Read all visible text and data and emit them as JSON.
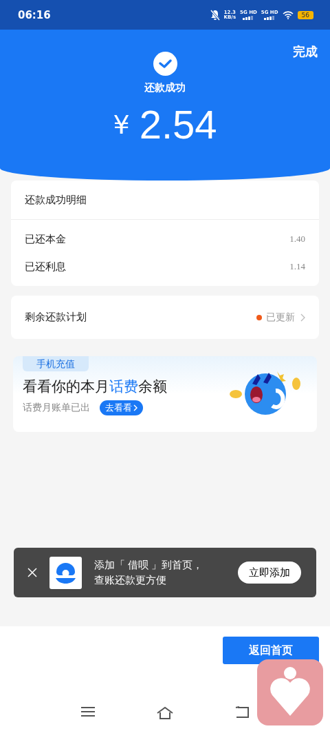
{
  "status_bar": {
    "time": "06:16",
    "speed_value": "12.3",
    "speed_unit": "KB/s",
    "networks": [
      "5G HD",
      "5G HD"
    ],
    "battery": "56"
  },
  "header": {
    "done": "完成",
    "title": "还款成功",
    "currency": "¥",
    "amount": "2.54"
  },
  "details": {
    "title": "还款成功明细",
    "rows": [
      {
        "label": "已还本金",
        "value": "1.40"
      },
      {
        "label": "已还利息",
        "value": "1.14"
      }
    ]
  },
  "plan": {
    "label": "剩余还款计划",
    "status": "已更新",
    "color": "#f05a1a"
  },
  "banner": {
    "tag": "手机充值",
    "headline": "看看你的本月**话费**余额",
    "subtitle": "话费月账单已出",
    "button": "去看看"
  },
  "toast": {
    "line1": "添加「 借呗 」到首页，",
    "line2": "查账还款更方便",
    "button": "立即添加"
  },
  "footer": {
    "button": "返回首页"
  }
}
